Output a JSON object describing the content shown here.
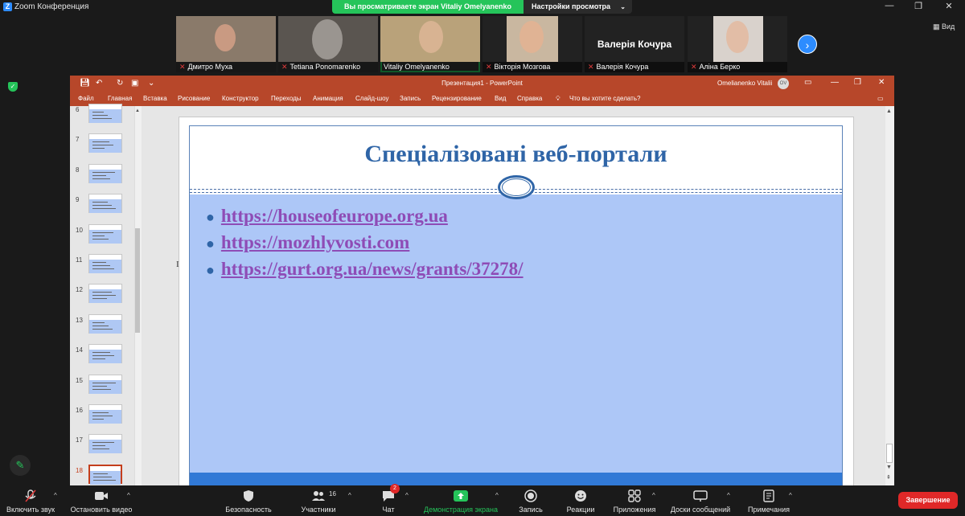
{
  "window": {
    "title": "Zoom Конференция",
    "share_banner": "Вы просматриваете экран Vitaliy Omelyanenko",
    "view_options": "Настройки просмотра",
    "view_button": "Вид"
  },
  "participants": [
    {
      "name": "Дмитро Муха",
      "muted": true
    },
    {
      "name": "Tetiana Ponomarenko",
      "muted": true
    },
    {
      "name": "Vitaliy Omelyanenko",
      "muted": false
    },
    {
      "name": "Вікторія Мозгова",
      "muted": true
    },
    {
      "name": "Валерія Кочура",
      "muted": true,
      "placeholder": "Валерія Кочура"
    },
    {
      "name": "Аліна Берко",
      "muted": true
    }
  ],
  "powerpoint": {
    "doc_title": "Презентация1  -  PowerPoint",
    "user": "Omelianenko Vitalii",
    "user_initials": "OV",
    "menu": [
      "Файл",
      "Главная",
      "Вставка",
      "Рисование",
      "Конструктор",
      "Переходы",
      "Анимация",
      "Слайд-шоу",
      "Запись",
      "Рецензирование",
      "Вид",
      "Справка"
    ],
    "tell_me": "Что вы хотите сделать?",
    "slide_numbers": [
      "6",
      "7",
      "8",
      "9",
      "10",
      "11",
      "12",
      "13",
      "14",
      "15",
      "16",
      "17",
      "18"
    ],
    "selected_slide": "18",
    "slide": {
      "title": "Спеціалізовані веб-портали",
      "links": [
        "https://houseofeurope.org.ua",
        "https://mozhlyvosti.com",
        "https://gurt.org.ua/news/grants/37278/"
      ]
    }
  },
  "toolbar": {
    "unmute": "Включить звук",
    "stop_video": "Остановить видео",
    "security": "Безопасность",
    "participants": "Участники",
    "participants_count": "16",
    "chat": "Чат",
    "chat_badge": "2",
    "share_screen": "Демонстрация экрана",
    "record": "Запись",
    "reactions": "Реакции",
    "apps": "Приложения",
    "whiteboards": "Доски сообщений",
    "notes": "Примечания",
    "end": "Завершение"
  },
  "colors": {
    "zoom_green": "#25c45a",
    "zoom_blue": "#2d8cff",
    "ppt_red": "#b7472a",
    "slide_title": "#2f65a7",
    "link_purple": "#8e4cb6",
    "end_red": "#e02828"
  }
}
